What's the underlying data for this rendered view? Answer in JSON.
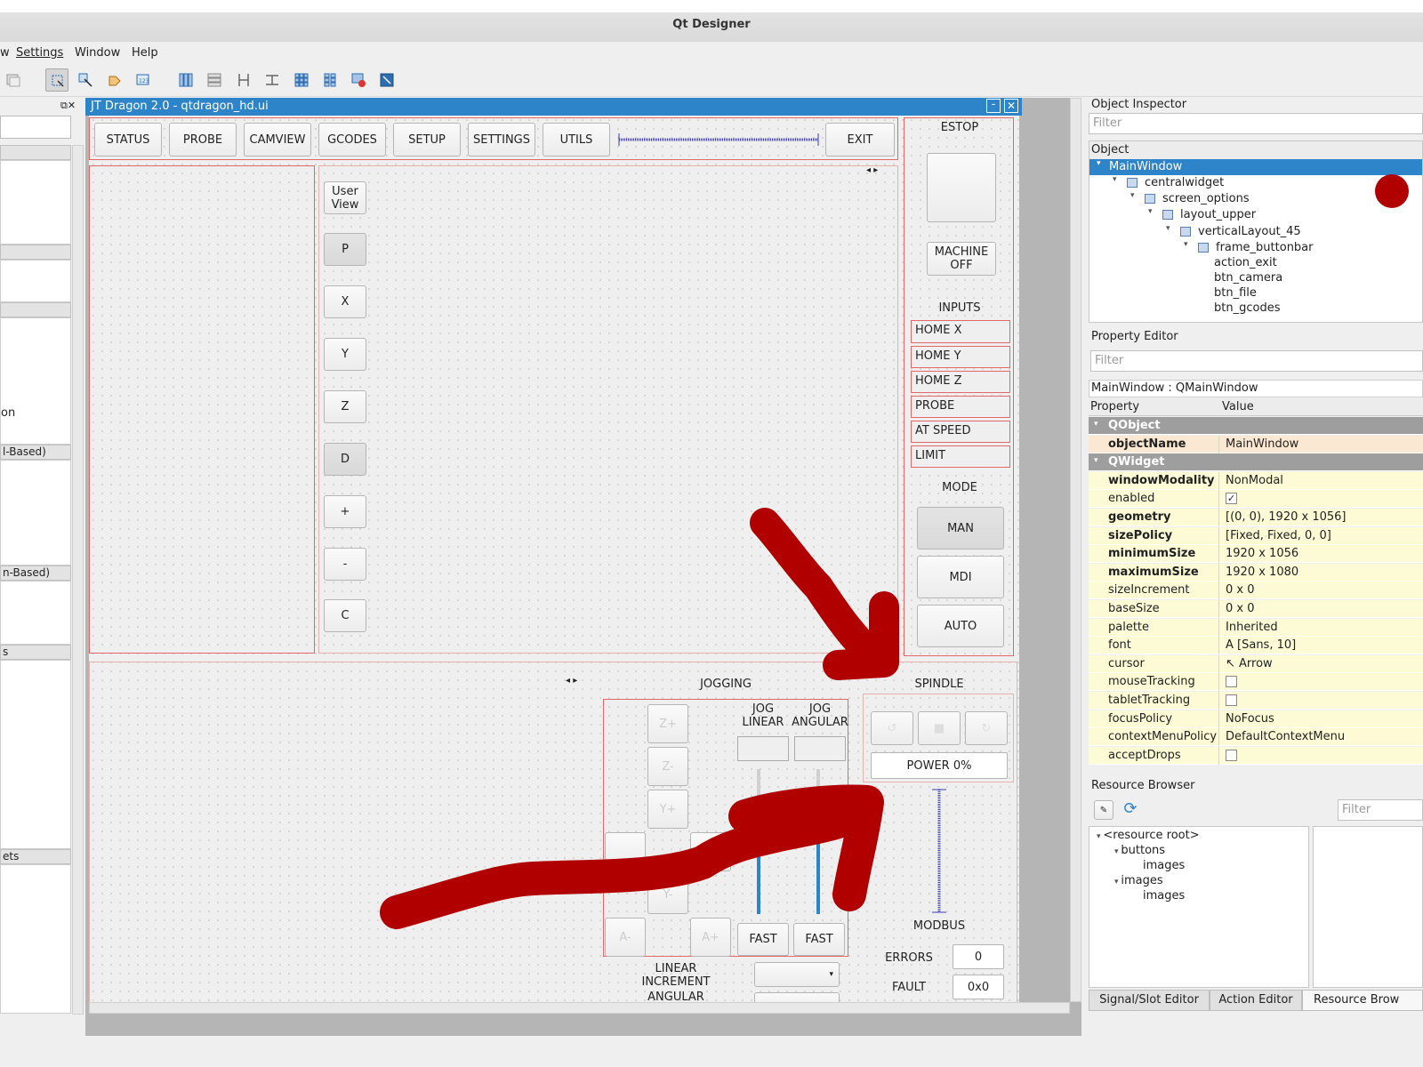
{
  "app": {
    "title": "Qt Designer"
  },
  "menubar": {
    "items": [
      "w",
      "Settings",
      "Window",
      "Help"
    ]
  },
  "form": {
    "window_title": "JT Dragon 2.0 - qtdragon_hd.ui",
    "buttonbar": [
      "STATUS",
      "PROBE",
      "CAMVIEW",
      "GCODES",
      "SETUP",
      "SETTINGS",
      "UTILS"
    ],
    "exit_label": "EXIT",
    "view_buttons": [
      "User\nView",
      "P",
      "X",
      "Y",
      "Z",
      "D",
      "+",
      "-",
      "C"
    ],
    "estop_label": "ESTOP",
    "machine_off_label": "MACHINE\nOFF",
    "inputs_label": "INPUTS",
    "inputs": [
      "HOME X",
      "HOME Y",
      "HOME Z",
      "PROBE",
      "AT SPEED",
      "LIMIT"
    ],
    "mode_label": "MODE",
    "modes": [
      "MAN",
      "MDI",
      "AUTO"
    ],
    "jogging_label": "JOGGING",
    "jog_linear_label": "JOG\nLINEAR",
    "jog_angular_label": "JOG\nANGULAR",
    "jog_buttons": [
      "Z+",
      "Z-",
      "Y+",
      "Y-",
      "A-",
      "A+"
    ],
    "fast_label": "FAST",
    "linear_increment_label": "LINEAR\nINCREMENT",
    "angular_label": "ANGULAR",
    "spindle_label": "SPINDLE",
    "power_label": "POWER 0%",
    "modbus_label": "MODBUS",
    "errors_label": "ERRORS",
    "errors_value": "0",
    "fault_label": "FAULT",
    "fault_value": "0x0"
  },
  "left_dock": {
    "sections": [
      "",
      "",
      "l-Based)",
      "n-Based)",
      "s",
      "ets"
    ],
    "fragment_text": "on"
  },
  "object_inspector": {
    "title": "Object Inspector",
    "filter_placeholder": "Filter",
    "column": "Object",
    "tree": [
      "MainWindow",
      "centralwidget",
      "screen_options",
      "layout_upper",
      "verticalLayout_45",
      "frame_buttonbar",
      "action_exit",
      "btn_camera",
      "btn_file",
      "btn_gcodes"
    ]
  },
  "property_editor": {
    "title": "Property Editor",
    "filter_placeholder": "Filter",
    "class_line": "MainWindow : QMainWindow",
    "col_property": "Property",
    "col_value": "Value",
    "rows": [
      {
        "name": "QObject",
        "value": "",
        "kind": "group"
      },
      {
        "name": "objectName",
        "value": "MainWindow",
        "kind": "bold"
      },
      {
        "name": "QWidget",
        "value": "",
        "kind": "group"
      },
      {
        "name": "windowModality",
        "value": "NonModal",
        "kind": "bold"
      },
      {
        "name": "enabled",
        "value": "✓",
        "kind": "check"
      },
      {
        "name": "geometry",
        "value": "[(0, 0), 1920 x 1056]",
        "kind": "bold"
      },
      {
        "name": "sizePolicy",
        "value": "[Fixed, Fixed, 0, 0]",
        "kind": "bold"
      },
      {
        "name": "minimumSize",
        "value": "1920 x 1056",
        "kind": "bold"
      },
      {
        "name": "maximumSize",
        "value": "1920 x 1080",
        "kind": "bold"
      },
      {
        "name": "sizeIncrement",
        "value": "0 x 0",
        "kind": "plain"
      },
      {
        "name": "baseSize",
        "value": "0 x 0",
        "kind": "plain"
      },
      {
        "name": "palette",
        "value": "Inherited",
        "kind": "plain"
      },
      {
        "name": "font",
        "value": "A  [Sans, 10]",
        "kind": "plain"
      },
      {
        "name": "cursor",
        "value": "↖  Arrow",
        "kind": "plain"
      },
      {
        "name": "mouseTracking",
        "value": "",
        "kind": "check"
      },
      {
        "name": "tabletTracking",
        "value": "",
        "kind": "check"
      },
      {
        "name": "focusPolicy",
        "value": "NoFocus",
        "kind": "plain"
      },
      {
        "name": "contextMenuPolicy",
        "value": "DefaultContextMenu",
        "kind": "plain"
      },
      {
        "name": "acceptDrops",
        "value": "",
        "kind": "check"
      }
    ]
  },
  "resource_browser": {
    "title": "Resource Browser",
    "filter_placeholder": "Filter",
    "tree": [
      "<resource root>",
      "buttons",
      "images",
      "images",
      "images"
    ]
  },
  "bottom_tabs": [
    "Signal/Slot Editor",
    "Action Editor",
    "Resource Brow"
  ],
  "colors": {
    "annotation": "#b00000",
    "selection": "#2e84c8"
  }
}
